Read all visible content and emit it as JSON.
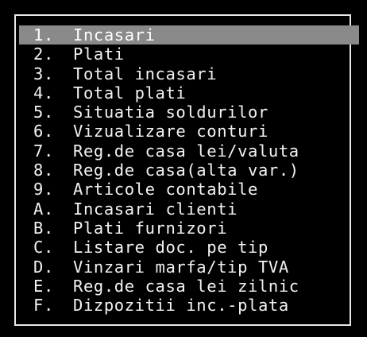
{
  "menu": {
    "selected_index": 0,
    "items": [
      {
        "key": "1.",
        "label": "Incasari"
      },
      {
        "key": "2.",
        "label": "Plati"
      },
      {
        "key": "3.",
        "label": "Total incasari"
      },
      {
        "key": "4.",
        "label": "Total plati"
      },
      {
        "key": "5.",
        "label": "Situatia soldurilor"
      },
      {
        "key": "6.",
        "label": "Vizualizare conturi"
      },
      {
        "key": "7.",
        "label": "Reg.de casa lei/valuta"
      },
      {
        "key": "8.",
        "label": "Reg.de casa(alta var.)"
      },
      {
        "key": "9.",
        "label": "Articole contabile"
      },
      {
        "key": "A.",
        "label": "Incasari clienti"
      },
      {
        "key": "B.",
        "label": "Plati furnizori"
      },
      {
        "key": "C.",
        "label": "Listare doc. pe tip"
      },
      {
        "key": "D.",
        "label": "Vinzari marfa/tip TVA"
      },
      {
        "key": "E.",
        "label": "Reg.de casa lei zilnic"
      },
      {
        "key": "F.",
        "label": "Dizpozitii inc.-plata"
      }
    ]
  },
  "colors": {
    "background": "#000000",
    "text": "#f2f2f2",
    "highlight": "#8a8a8a",
    "border": "#e8e8e8"
  }
}
